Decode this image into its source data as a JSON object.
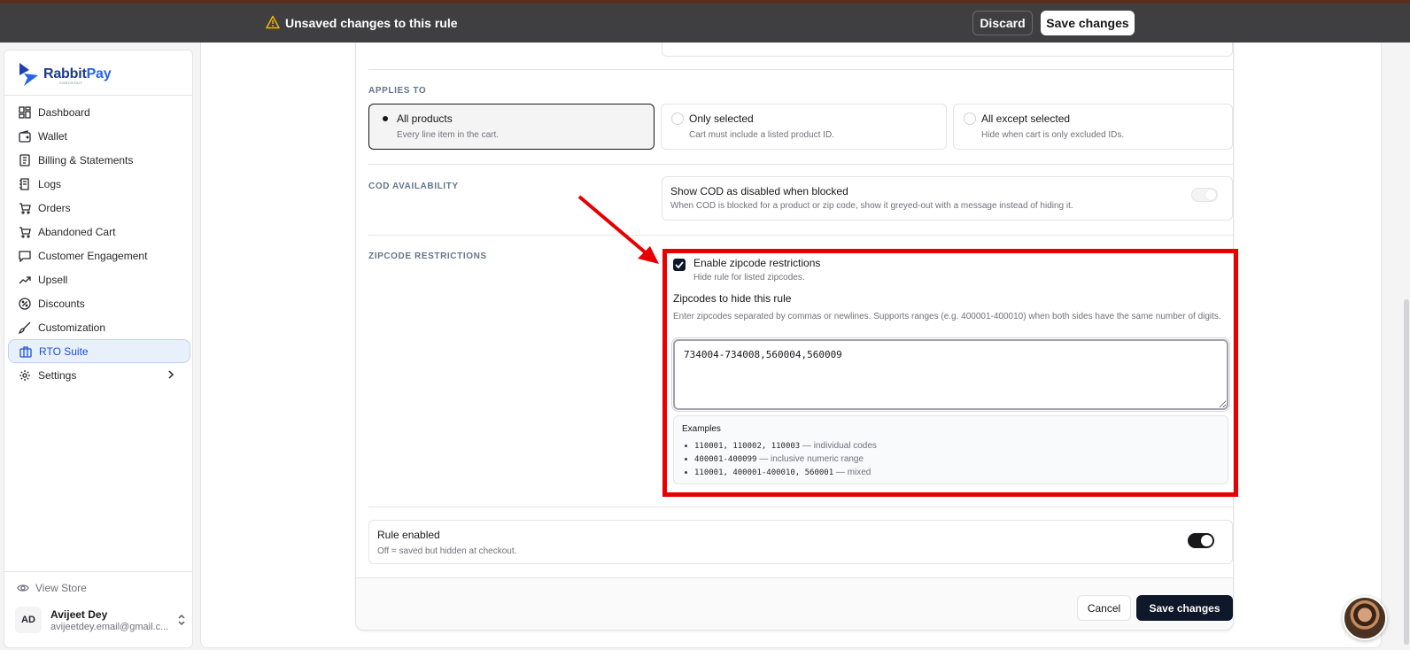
{
  "savebar": {
    "message": "Unsaved changes to this rule",
    "discard_label": "Discard",
    "save_label": "Save changes"
  },
  "brand": {
    "name_part1": "Rabbit",
    "name_part2": "Pay",
    "sub": "CHECKOUT",
    "accent": "#2563eb"
  },
  "sidebar": {
    "items": [
      {
        "label": "Dashboard",
        "icon": "dashboard-icon"
      },
      {
        "label": "Wallet",
        "icon": "wallet-icon"
      },
      {
        "label": "Billing & Statements",
        "icon": "receipt-icon"
      },
      {
        "label": "Logs",
        "icon": "logs-icon"
      },
      {
        "label": "Orders",
        "icon": "cart-icon"
      },
      {
        "label": "Abandoned Cart",
        "icon": "cart-icon"
      },
      {
        "label": "Customer Engagement",
        "icon": "message-icon"
      },
      {
        "label": "Upsell",
        "icon": "trending-up-icon"
      },
      {
        "label": "Discounts",
        "icon": "discount-icon"
      },
      {
        "label": "Customization",
        "icon": "brush-icon"
      },
      {
        "label": "RTO Suite",
        "icon": "briefcase-icon",
        "active": true
      },
      {
        "label": "Settings",
        "icon": "gear-icon"
      }
    ],
    "view_store": "View Store",
    "user": {
      "initials": "AD",
      "name": "Avijeet Dey",
      "email": "avijeetdey.email@gmail.c..."
    }
  },
  "applies_to": {
    "label": "APPLIES TO",
    "options": [
      {
        "title": "All products",
        "desc": "Every line item in the cart.",
        "selected": true
      },
      {
        "title": "Only selected",
        "desc": "Cart must include a listed product ID.",
        "selected": false
      },
      {
        "title": "All except selected",
        "desc": "Hide when cart is only excluded IDs.",
        "selected": false
      }
    ]
  },
  "cod": {
    "label": "COD AVAILABILITY",
    "title": "Show COD as disabled when blocked",
    "desc": "When COD is blocked for a product or zip code, show it greyed-out with a message instead of hiding it.",
    "enabled": false
  },
  "zipcode": {
    "label": "ZIPCODE RESTRICTIONS",
    "checkbox_title": "Enable zipcode restrictions",
    "checkbox_desc": "Hide rule for listed zipcodes.",
    "checked": true,
    "field_title": "Zipcodes to hide this rule",
    "help": "Enter zipcodes separated by commas or newlines. Supports ranges (e.g. 400001-400010) when both sides have the same number of digits.",
    "value": "734004-734008,560004,560009",
    "examples_title": "Examples",
    "examples": [
      {
        "code": "110001, 110002, 110003",
        "note": " — individual codes"
      },
      {
        "code": "400001-400099",
        "note": " — inclusive numeric range"
      },
      {
        "code": "110001, 400001-400010, 560001",
        "note": " — mixed"
      }
    ]
  },
  "rule": {
    "title": "Rule enabled",
    "desc": "Off = saved but hidden at checkout.",
    "enabled": true
  },
  "footer": {
    "cancel_label": "Cancel",
    "save_label": "Save changes"
  },
  "colors": {
    "highlight": "#e60000",
    "primary_dark": "#0f172a",
    "active_nav_bg": "#e8f0fc"
  }
}
